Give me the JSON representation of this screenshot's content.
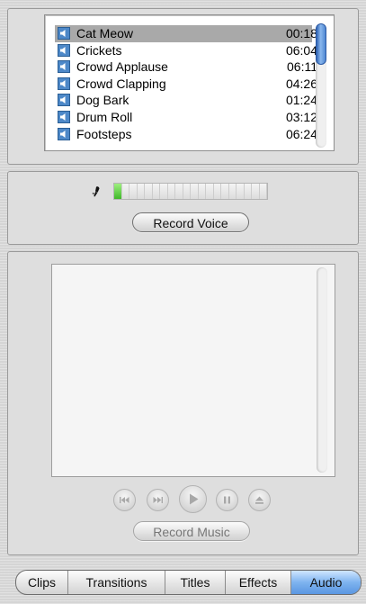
{
  "audio_list": {
    "items": [
      {
        "name": "Cat Meow",
        "duration": "00:18",
        "selected": true
      },
      {
        "name": "Crickets",
        "duration": "06:04"
      },
      {
        "name": "Crowd Applause",
        "duration": "06:11"
      },
      {
        "name": "Crowd Clapping",
        "duration": "04:26"
      },
      {
        "name": "Dog Bark",
        "duration": "01:24"
      },
      {
        "name": "Drum Roll",
        "duration": "03:12"
      },
      {
        "name": "Footsteps",
        "duration": "06:24"
      }
    ]
  },
  "voice": {
    "record_label": "Record Voice",
    "level_fraction": 0.05
  },
  "music": {
    "record_label": "Record Music",
    "transport": [
      "rewind-icon",
      "fast-forward-icon",
      "play-icon",
      "pause-icon",
      "eject-icon"
    ]
  },
  "tabs": [
    {
      "label": "Clips"
    },
    {
      "label": "Transitions"
    },
    {
      "label": "Titles"
    },
    {
      "label": "Effects"
    },
    {
      "label": "Audio",
      "active": true
    }
  ],
  "colors": {
    "accent_blue": "#5a96e2",
    "selection_gray": "#a9a9a9",
    "meter_green": "#3fb82a"
  }
}
